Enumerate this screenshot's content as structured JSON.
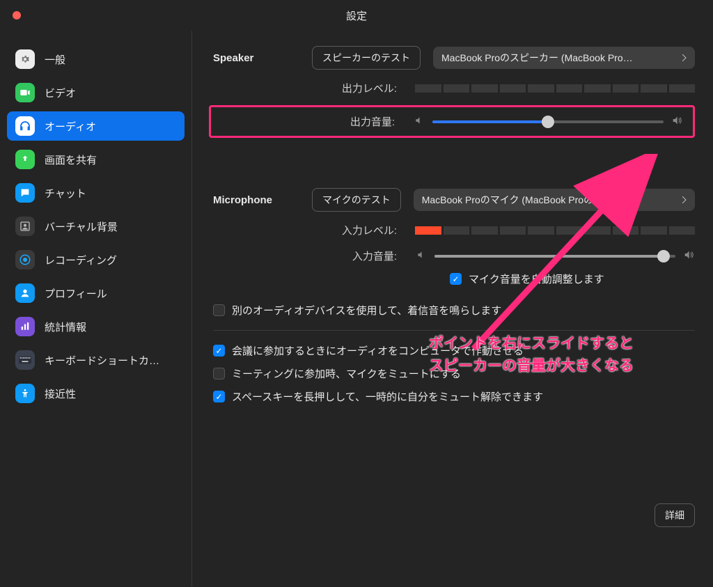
{
  "window": {
    "title": "設定"
  },
  "sidebar": {
    "items": [
      {
        "label": "一般"
      },
      {
        "label": "ビデオ"
      },
      {
        "label": "オーディオ"
      },
      {
        "label": "画面を共有"
      },
      {
        "label": "チャット"
      },
      {
        "label": "バーチャル背景"
      },
      {
        "label": "レコーディング"
      },
      {
        "label": "プロフィール"
      },
      {
        "label": "統計情報"
      },
      {
        "label": "キーボードショートカ…"
      },
      {
        "label": "接近性"
      }
    ]
  },
  "speaker": {
    "header": "Speaker",
    "test_button": "スピーカーのテスト",
    "device": "MacBook Proのスピーカー (MacBook Pro…",
    "output_level_label": "出力レベル:",
    "output_level_value_segments": 10,
    "output_level_active_segments": 0,
    "output_volume_label": "出力音量:",
    "output_volume_percent": 50
  },
  "microphone": {
    "header": "Microphone",
    "test_button": "マイクのテスト",
    "device": "MacBook Proのマイク (MacBook Proのマ…",
    "input_level_label": "入力レベル:",
    "input_level_value_segments": 10,
    "input_level_active_segments": 1,
    "input_volume_label": "入力音量:",
    "input_volume_percent": 95,
    "auto_adjust": {
      "label": "マイク音量を自動調整します",
      "checked": true
    }
  },
  "other": {
    "ringtone_device": {
      "label": "別のオーディオデバイスを使用して、着信音を鳴らします",
      "checked": false
    }
  },
  "join_opts": [
    {
      "label": "会議に参加するときにオーディオをコンピュータで作動させる",
      "checked": true
    },
    {
      "label": "ミーティングに参加時、マイクをミュートにする",
      "checked": false
    },
    {
      "label": "スペースキーを長押しして、一時的に自分をミュート解除できます",
      "checked": true
    }
  ],
  "detail_button": "詳細",
  "annotation": {
    "line1": "ポイントを右にスライドすると",
    "line2": "スピーカーの音量が大きくなる"
  }
}
